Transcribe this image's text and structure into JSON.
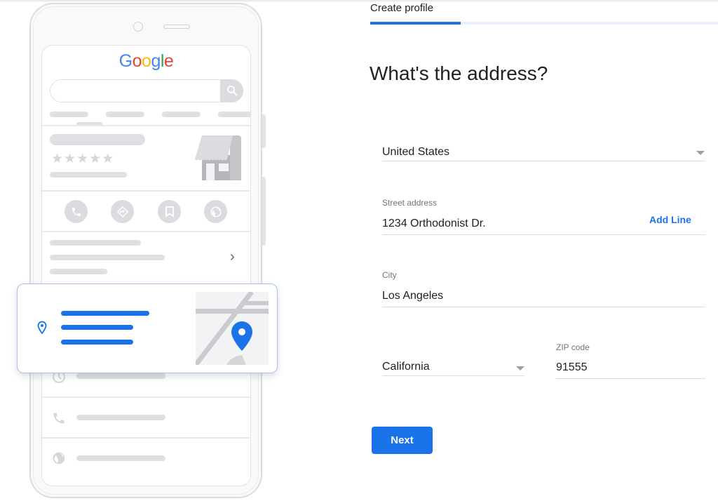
{
  "header": {
    "title": "Create profile",
    "progress_percent": 26
  },
  "form": {
    "question": "What's the address?",
    "country": {
      "value": "United States",
      "icon": "dropdown-arrow-icon"
    },
    "street": {
      "label": "Street address",
      "value": "1234 Orthodonist Dr.",
      "add_line_label": "Add Line"
    },
    "city": {
      "label": "City",
      "value": "Los Angeles"
    },
    "state": {
      "value": "California",
      "icon": "dropdown-arrow-icon"
    },
    "zip": {
      "label": "ZIP code",
      "value": "91555"
    },
    "next_label": "Next"
  },
  "illustration": {
    "logo": {
      "letters": [
        "G",
        "o",
        "o",
        "g",
        "l",
        "e"
      ],
      "colors": [
        "#4285f4",
        "#ea4335",
        "#fbbc05",
        "#4285f4",
        "#34a853",
        "#ea4335"
      ]
    },
    "icons": [
      "search-icon",
      "store-icon",
      "phone-icon",
      "directions-icon",
      "bookmark-icon",
      "globe-icon",
      "chevron-right-icon",
      "location-pin-icon",
      "map-pin-icon",
      "clock-icon"
    ],
    "stars": "★★★★★",
    "chevron": "›"
  },
  "colors": {
    "accent": "#1a73e8",
    "text": "#202124",
    "label": "#70757a",
    "placeholder_gray": "#dadce0"
  }
}
